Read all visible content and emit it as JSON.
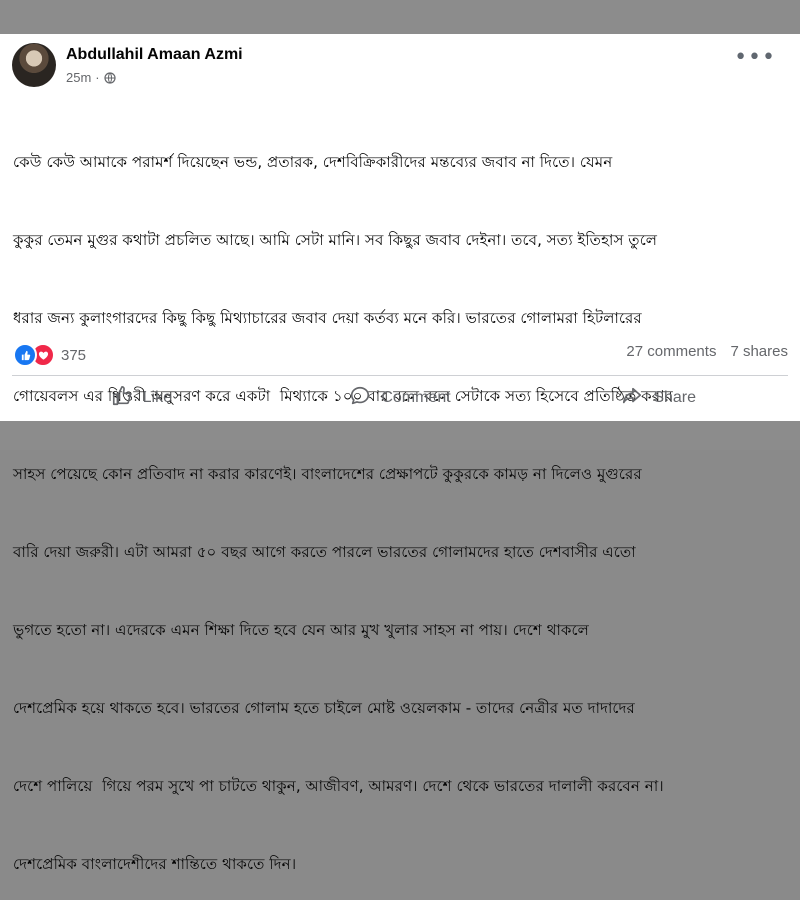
{
  "post": {
    "author": "Abdullahil Amaan Azmi",
    "time": "25m",
    "time_separator": "·",
    "privacy_icon": "globe-icon",
    "more_icon": "more-options-icon",
    "more_label": "•••",
    "lines": [
      "কেউ কেউ আমাকে পরামর্শ দিয়েছেন ভন্ড, প্রতারক, দেশবিক্রিকারীদের মন্তব্যের জবাব না দিতে। যেমন",
      "কুকুর তেমন মুগুর কথাটা প্রচলিত আছে। আমি সেটা মানি। সব কিছুর জবাব দেইনা। তবে, সত্য ইতিহাস তুলে",
      "ধরার জন্য কুলাংগারদের কিছু কিছু মিথ্যাচারের জবাব দেয়া কর্তব্য মনে করি। ভারতের গোলামরা হিটলারের",
      "গোয়েবলস এর থিওরী অনুসরণ করে একটা  মিথ্যাকে ১০০ বার বলে বলে সেটাকে সত্য হিসেবে প্রতিষ্ঠিত করার",
      "সাহস পেয়েছে কোন প্রতিবাদ না করার কারণেই। বাংলাদেশের প্রেক্ষাপটে কুকুরকে কামড় না দিলেও মুগুরের",
      "বারি দেয়া জরুরী। এটা আমরা ৫০ বছর আগে করতে পারলে ভারতের গোলামদের হাতে দেশবাসীর এতো",
      "ভুগতে হতো না। এদেরকে এমন শিক্ষা দিতে হবে যেন আর মুখ খুলার সাহস না পায়। দেশে থাকলে",
      "দেশপ্রেমিক হয়ে থাকতে হবে। ভারতের গোলাম হতে চাইলে মোষ্ট ওয়েলকাম - তাদের নেত্রীর মত দাদাদের",
      "দেশে পালিয়ে  গিয়ে পরম সুখে পা চাটতে থাকুন, আজীবণ, আমরণ। দেশে থেকে ভারতের দালালী করবেন না।",
      "দেশপ্রেমিক বাংলাদেশীদের শান্তিতে থাকতে দিন।"
    ]
  },
  "stats": {
    "reaction_icons": [
      "like-reaction-icon",
      "love-reaction-icon"
    ],
    "reaction_count": "375",
    "comments": "27 comments",
    "shares": "7 shares"
  },
  "actions": {
    "like": "Like",
    "comment": "Comment",
    "share": "Share"
  },
  "colors": {
    "frame": "#8c8c8c",
    "card": "#ffffff",
    "text": "#050505",
    "muted": "#65676b",
    "like_blue": "#1877f2",
    "love_red": "#f02849"
  }
}
